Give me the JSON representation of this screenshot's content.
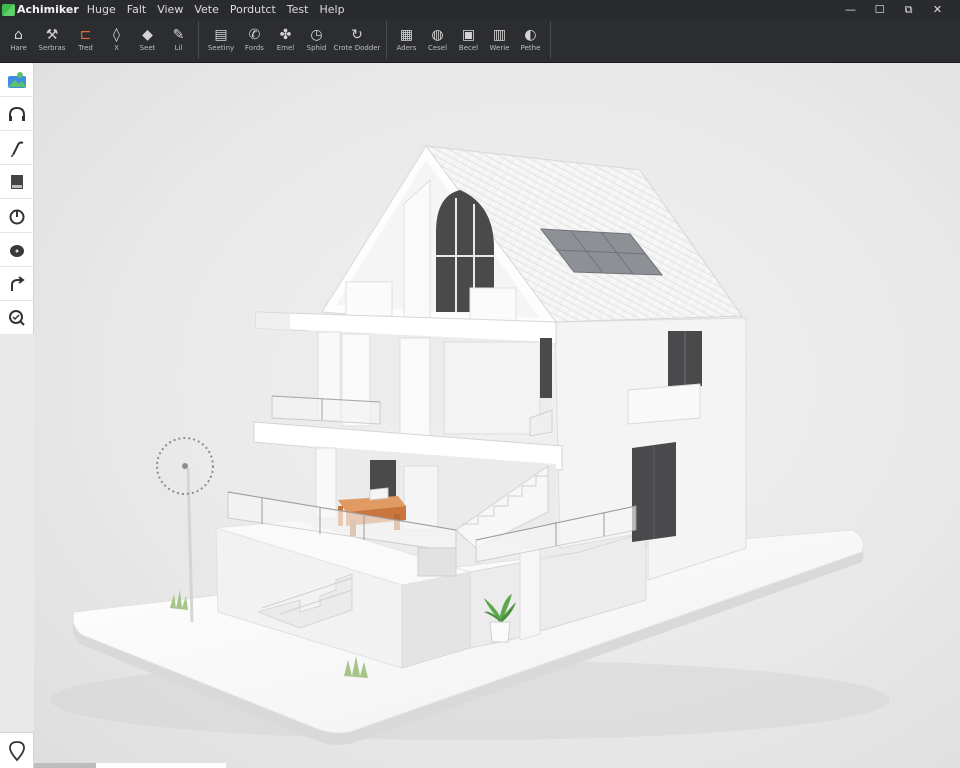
{
  "app": {
    "name": "Achimiker",
    "menu": [
      "Huge",
      "Falt",
      "View",
      "Vete",
      "Pordutct",
      "Test",
      "Help"
    ],
    "window_controls": {
      "minimize": "—",
      "maximize": "☐",
      "restore": "⧉",
      "close": "✕"
    }
  },
  "toolbar": {
    "items": [
      {
        "label": "Hare",
        "icon": "home-icon"
      },
      {
        "label": "Serbras",
        "icon": "brush-icon"
      },
      {
        "label": "Tred",
        "icon": "layer-icon"
      },
      {
        "label": "X",
        "icon": "droplet-icon"
      },
      {
        "label": "Seet",
        "icon": "eraser-icon"
      },
      {
        "label": "Lil",
        "icon": "pencil-icon"
      },
      {
        "label": "Seetiny",
        "icon": "panel-icon"
      },
      {
        "label": "Fords",
        "icon": "phone-icon"
      },
      {
        "label": "Emel",
        "icon": "puzzle-icon"
      },
      {
        "label": "Sphid",
        "icon": "clock-icon"
      },
      {
        "label": "Crote Dodder",
        "icon": "refresh-icon"
      },
      {
        "label": "Aders",
        "icon": "library-icon"
      },
      {
        "label": "Cesel",
        "icon": "bucket-icon"
      },
      {
        "label": "Becel",
        "icon": "calculator-icon"
      },
      {
        "label": "Werie",
        "icon": "document-icon"
      },
      {
        "label": "Pethe",
        "icon": "sound-icon"
      }
    ]
  },
  "palette": {
    "items": [
      {
        "icon": "landscape-icon"
      },
      {
        "icon": "headphones-icon"
      },
      {
        "icon": "wand-icon"
      },
      {
        "icon": "book-icon"
      },
      {
        "icon": "power-icon"
      },
      {
        "icon": "shape-icon"
      },
      {
        "icon": "redo-icon"
      },
      {
        "icon": "zoom-icon"
      }
    ],
    "bottom_icon": "location-pin-icon"
  },
  "viewport": {
    "model": "house-3d-model",
    "colors": {
      "building": "#f7f7f7",
      "shadow_side": "#e3e3e3",
      "window_dark": "#4a4a4d",
      "solar_panel": "#8d9196",
      "table": "#d7894e",
      "plant": "#5aa84b",
      "ground": "#ffffff"
    }
  }
}
